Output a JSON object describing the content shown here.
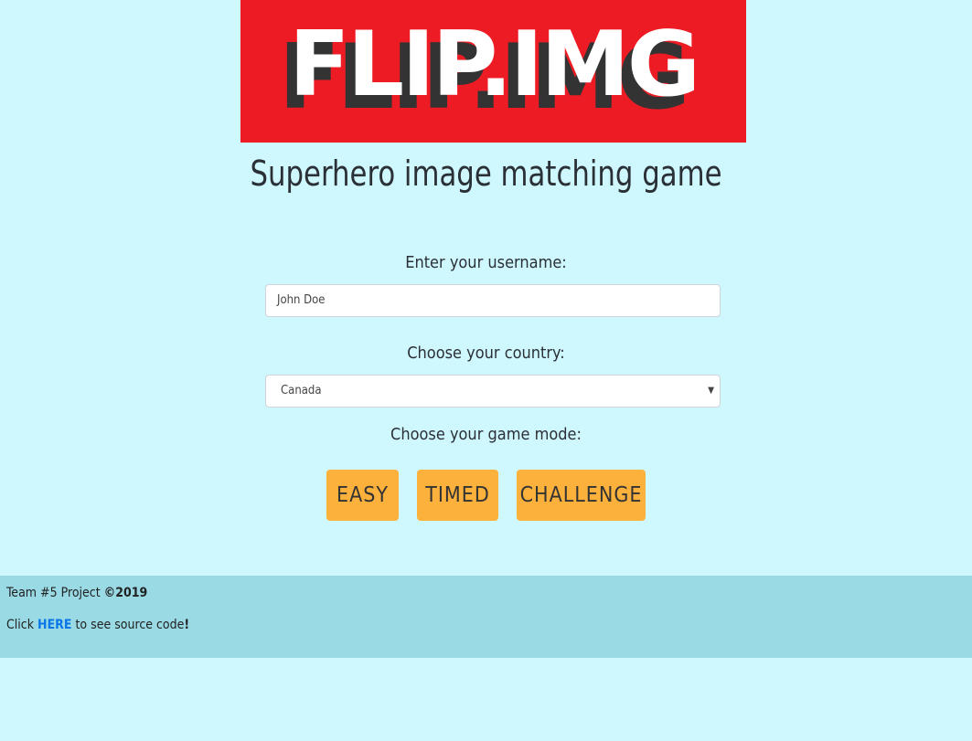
{
  "logo": {
    "text": "FLIP.IMG",
    "background_color": "#ed1c24"
  },
  "subtitle": "Superhero image matching game",
  "form": {
    "username_label": "Enter your username:",
    "username_value": "John Doe",
    "country_label": "Choose your country:",
    "country_selected": "Canada",
    "mode_label": "Choose your game mode:"
  },
  "modes": {
    "easy": "EASY",
    "timed": "TIMED",
    "challenge": "CHALLENGE",
    "button_color": "#fbb13c"
  },
  "footer": {
    "team_text": "Team #5 Project",
    "copyright": "©2019",
    "click_text": "Click",
    "here_link": "HERE",
    "source_text": "to see source code",
    "exclaim": "!",
    "background_color": "#99dae5"
  },
  "colors": {
    "page_background": "#cff8fe",
    "link": "#0b76e8"
  }
}
